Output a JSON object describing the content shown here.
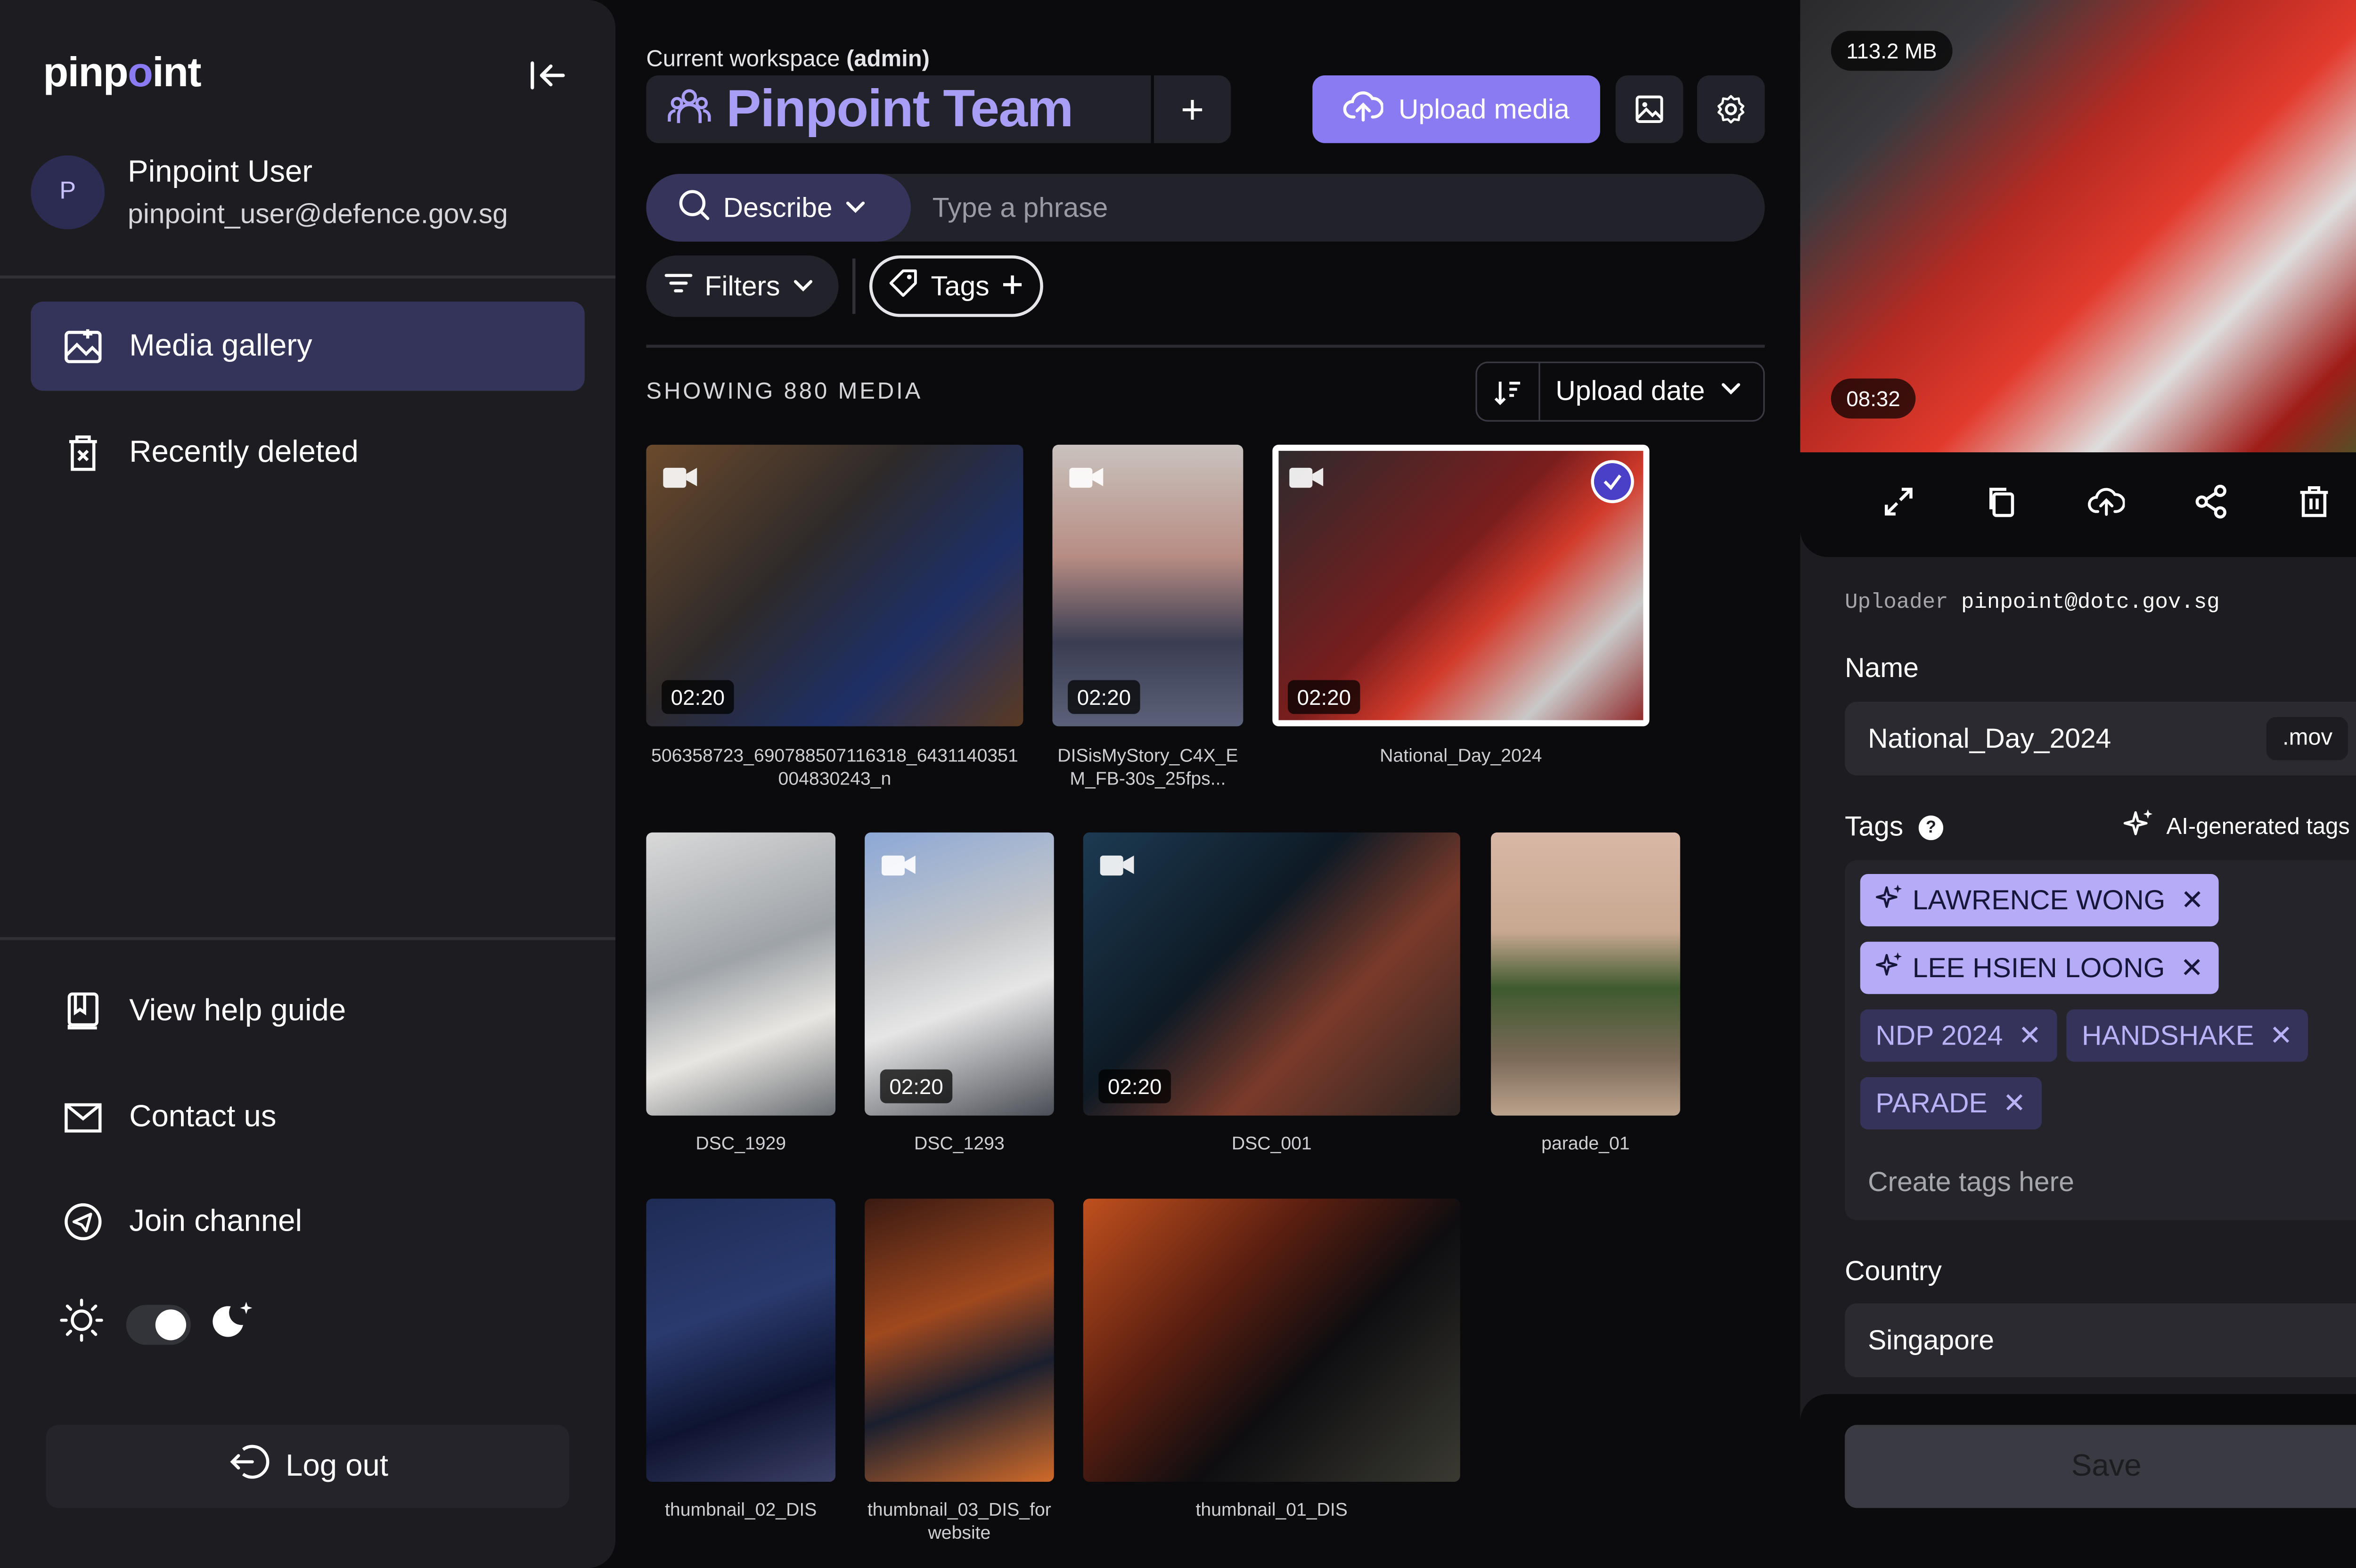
{
  "brand": {
    "name_prefix": "pinp",
    "name_dot": "o",
    "name_suffix": "int",
    "accent": "#8b7bf3"
  },
  "user": {
    "initial": "P",
    "name": "Pinpoint User",
    "email": "pinpoint_user@defence.gov.sg"
  },
  "nav": {
    "items": [
      {
        "label": "Media gallery",
        "icon": "gallery-icon",
        "active": true
      },
      {
        "label": "Recently deleted",
        "icon": "trash-icon",
        "active": false
      }
    ],
    "footer": [
      {
        "label": "View help guide",
        "icon": "help-guide-icon"
      },
      {
        "label": "Contact us",
        "icon": "mail-icon"
      },
      {
        "label": "Join channel",
        "icon": "telegram-icon"
      }
    ],
    "logout": "Log out",
    "theme": {
      "light_icon": "sun-icon",
      "dark_icon": "moon-icon",
      "mode": "dark"
    }
  },
  "workspace": {
    "label_prefix": "Current workspace ",
    "label_role": "(admin)",
    "name": "Pinpoint Team",
    "add": "+"
  },
  "toolbar": {
    "upload": "Upload media"
  },
  "search": {
    "mode": "Describe",
    "placeholder": "Type a phrase"
  },
  "filters": {
    "label": "Filters"
  },
  "tags_filter": {
    "label": "Tags"
  },
  "gallery": {
    "count_label": "SHOWING 880 MEDIA",
    "sort": "Upload date",
    "items": [
      {
        "caption": "506358723_690788507116318_6431140351004830243_n",
        "duration": "02:20",
        "video": true
      },
      {
        "caption": "DISisMyStory_C4X_EM_FB-30s_25fps...",
        "duration": "02:20",
        "video": true
      },
      {
        "caption": "National_Day_2024",
        "duration": "02:20",
        "video": true,
        "selected": true
      },
      {
        "caption": "DSC_1929",
        "duration": "",
        "video": false
      },
      {
        "caption": "DSC_1293",
        "duration": "02:20",
        "video": true
      },
      {
        "caption": "DSC_001",
        "duration": "02:20",
        "video": true
      },
      {
        "caption": "parade_01",
        "duration": "",
        "video": false
      },
      {
        "caption": "thumbnail_02_DIS",
        "duration": "",
        "video": false
      },
      {
        "caption": "thumbnail_03_DIS_forwebsite",
        "duration": "",
        "video": false
      },
      {
        "caption": "thumbnail_01_DIS",
        "duration": "",
        "video": false
      }
    ]
  },
  "detail": {
    "size": "113.2 MB",
    "time": "08:32",
    "uploader_label": "Uploader",
    "uploader": "pinpoint@dotc.gov.sg",
    "name_label": "Name",
    "name": "National_Day_2024",
    "ext": ".mov",
    "tags_label": "Tags",
    "ai_label": "AI-generated tags",
    "tags": [
      {
        "label": "LAWRENCE WONG",
        "ai": true
      },
      {
        "label": "LEE HSIEN LOONG",
        "ai": true
      },
      {
        "label": "NDP 2024",
        "ai": false
      },
      {
        "label": "HANDSHAKE",
        "ai": false
      },
      {
        "label": "PARADE",
        "ai": false
      }
    ],
    "create_tag_placeholder": "Create tags here",
    "country_label": "Country",
    "country": "Singapore",
    "save": "Save"
  }
}
